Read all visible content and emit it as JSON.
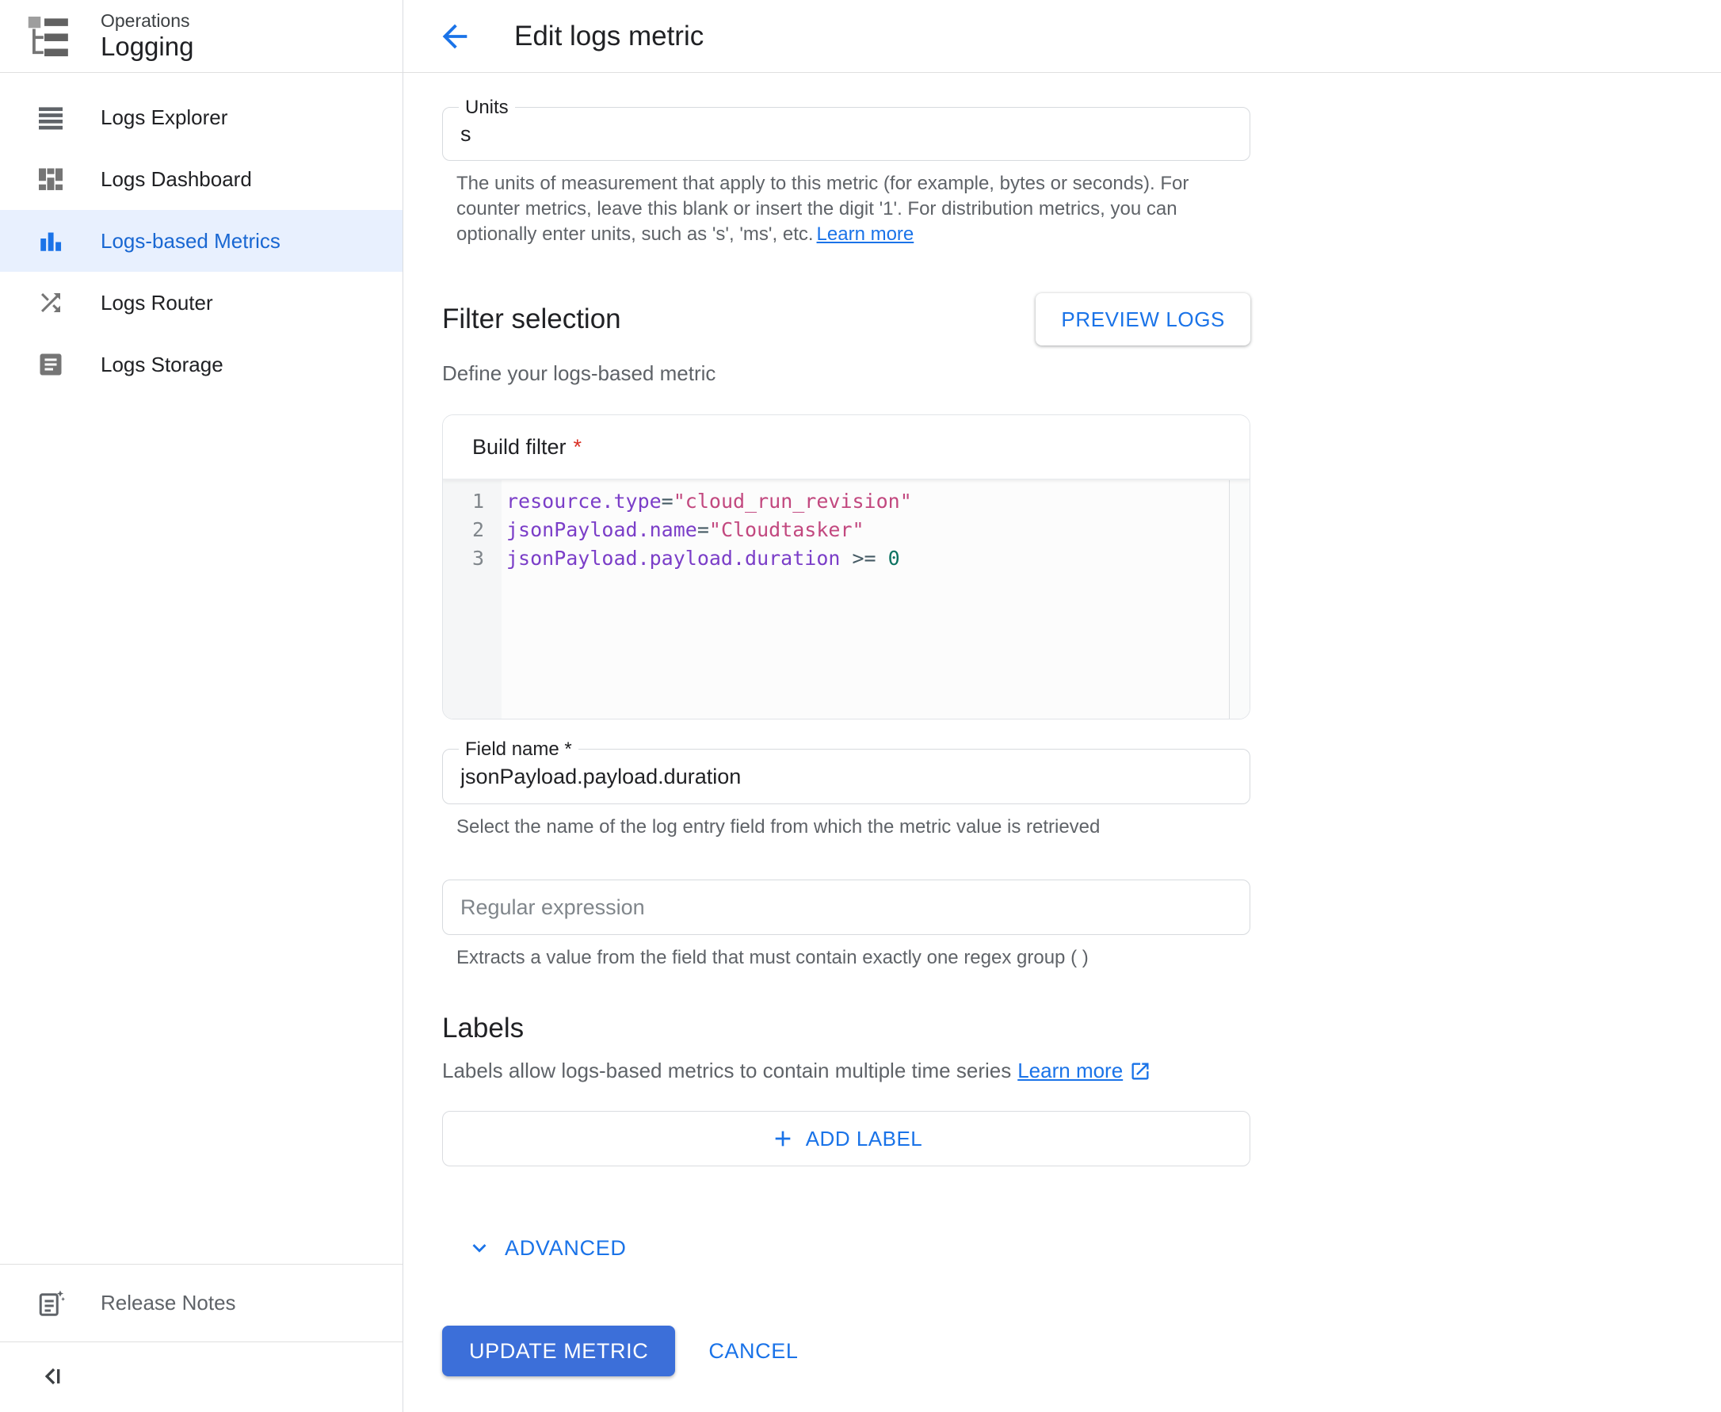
{
  "product": {
    "eyebrow": "Operations",
    "name": "Logging"
  },
  "sidebar": {
    "items": [
      {
        "label": "Logs Explorer",
        "icon": "logs-explorer-icon",
        "selected": false
      },
      {
        "label": "Logs Dashboard",
        "icon": "logs-dashboard-icon",
        "selected": false
      },
      {
        "label": "Logs-based Metrics",
        "icon": "logs-based-metrics-icon",
        "selected": true
      },
      {
        "label": "Logs Router",
        "icon": "logs-router-icon",
        "selected": false
      },
      {
        "label": "Logs Storage",
        "icon": "logs-storage-icon",
        "selected": false
      }
    ],
    "release_notes": {
      "label": "Release Notes",
      "icon": "release-notes-icon"
    },
    "collapse_icon": "collapse-sidenav-icon"
  },
  "header": {
    "back_icon": "back-arrow-icon",
    "title": "Edit logs metric"
  },
  "units": {
    "label": "Units",
    "value": "s",
    "help": "The units of measurement that apply to this metric (for example, bytes or seconds). For counter metrics, leave this blank or insert the digit '1'. For distribution metrics, you can optionally enter units, such as 's', 'ms', etc.",
    "learn_more": "Learn more"
  },
  "filter_selection": {
    "heading": "Filter selection",
    "preview_logs_button": "PREVIEW LOGS",
    "subtitle": "Define your logs-based metric",
    "build_filter": {
      "label": "Build filter",
      "required_marker": "*",
      "lines": [
        {
          "number": "1",
          "tokens": [
            {
              "type": "key",
              "text": "resource.type"
            },
            {
              "type": "op",
              "text": "="
            },
            {
              "type": "string",
              "text": "\"cloud_run_revision\""
            }
          ]
        },
        {
          "number": "2",
          "tokens": [
            {
              "type": "key",
              "text": "jsonPayload.name"
            },
            {
              "type": "op",
              "text": "="
            },
            {
              "type": "string",
              "text": "\"Cloudtasker\""
            }
          ]
        },
        {
          "number": "3",
          "tokens": [
            {
              "type": "key",
              "text": "jsonPayload.payload.duration"
            },
            {
              "type": "op",
              "text": " >= "
            },
            {
              "type": "number",
              "text": "0"
            }
          ]
        }
      ]
    }
  },
  "field_name": {
    "label": "Field name *",
    "value": "jsonPayload.payload.duration",
    "help": "Select the name of the log entry field from which the metric value is retrieved"
  },
  "regular_expression": {
    "placeholder": "Regular expression",
    "help": "Extracts a value from the field that must contain exactly one regex group ( )"
  },
  "labels": {
    "heading": "Labels",
    "description": "Labels allow logs-based metrics to contain multiple time series",
    "learn_more": "Learn more",
    "add_label_button": "ADD LABEL"
  },
  "advanced_toggle": "ADVANCED",
  "actions": {
    "update_button": "UPDATE METRIC",
    "cancel_button": "CANCEL"
  },
  "colors": {
    "accent_blue": "#1a73e8",
    "primary_button_blue": "#3c6fd9",
    "selected_item_bg": "#e8f0fe",
    "selected_item_text": "#1967d2",
    "code_key_purple": "#7b3ec8",
    "code_string_pink": "#c2487f",
    "code_operator_slate": "#455a64",
    "code_number_teal": "#0b7261",
    "required_red": "#d93025"
  }
}
